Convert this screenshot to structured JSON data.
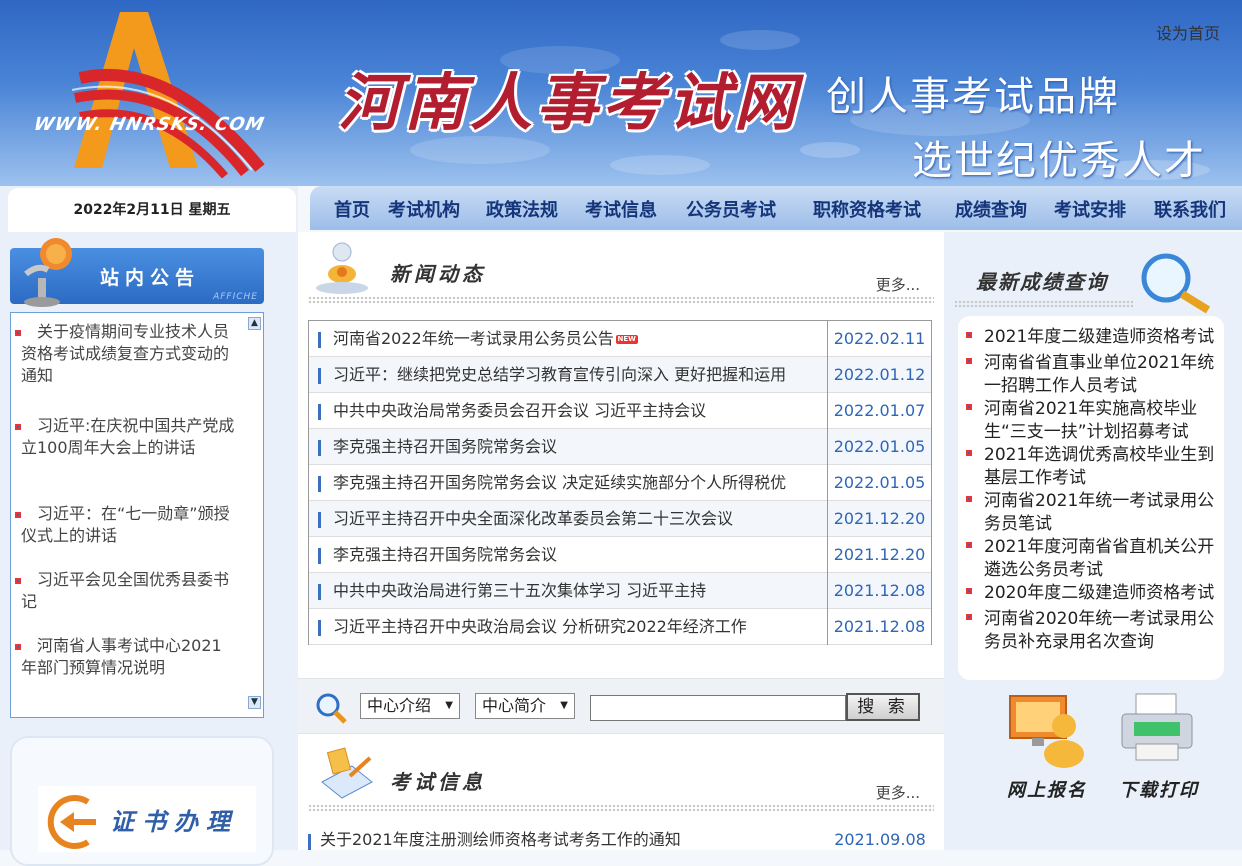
{
  "header": {
    "logo_text": "WWW. HNRSKS. COM",
    "site_title": "河南人事考试网",
    "slogan_1": "创人事考试品牌",
    "slogan_2": "选世纪优秀人才",
    "set_home": "设为首页"
  },
  "date": "2022年2月11日 星期五",
  "nav": [
    "首页",
    "考试机构",
    "政策法规",
    "考试信息",
    "公务员考试",
    "职称资格考试",
    "成绩查询",
    "考试安排",
    "联系我们"
  ],
  "notice": {
    "title": "站内公告",
    "subtitle": "AFFICHE",
    "items": [
      "关于疫情期间专业技术人员资格考试成绩复查方式变动的通知",
      "习近平:在庆祝中国共产党成立100周年大会上的讲话",
      "习近平：在“七一勋章”颁授仪式上的讲话",
      "习近平会见全国优秀县委书记",
      "河南省人事考试中心2021年部门预算情况说明"
    ]
  },
  "cert": {
    "title": "证书办理"
  },
  "news": {
    "title": "新闻动态",
    "more": "更多...",
    "new_badge": "NEW",
    "rows": [
      {
        "title": "河南省2022年统一考试录用公务员公告",
        "date": "2022.02.11",
        "is_new": true
      },
      {
        "title": "习近平：继续把党史总结学习教育宣传引向深入 更好把握和运用",
        "date": "2022.01.12"
      },
      {
        "title": "中共中央政治局常务委员会召开会议 习近平主持会议",
        "date": "2022.01.07"
      },
      {
        "title": "李克强主持召开国务院常务会议",
        "date": "2022.01.05"
      },
      {
        "title": "李克强主持召开国务院常务会议 决定延续实施部分个人所得税优",
        "date": "2022.01.05"
      },
      {
        "title": "习近平主持召开中央全面深化改革委员会第二十三次会议",
        "date": "2021.12.20"
      },
      {
        "title": "李克强主持召开国务院常务会议",
        "date": "2021.12.20"
      },
      {
        "title": "中共中央政治局进行第三十五次集体学习 习近平主持",
        "date": "2021.12.08"
      },
      {
        "title": "习近平主持召开中央政治局会议 分析研究2022年经济工作",
        "date": "2021.12.08"
      }
    ]
  },
  "search": {
    "select_1": "中心介绍",
    "select_2": "中心简介",
    "input_value": "",
    "button": "搜 索"
  },
  "exam_info": {
    "title": "考试信息",
    "more": "更多...",
    "rows": [
      {
        "title": "关于2021年度注册测绘师资格考试考务工作的通知",
        "date": "2021.09.08"
      }
    ]
  },
  "scores": {
    "title": "最新成绩查询",
    "items": [
      "2021年度二级建造师资格考试",
      "河南省省直事业单位2021年统一招聘工作人员考试",
      "河南省2021年实施高校毕业生“三支一扶”计划招募考试",
      "2021年选调优秀高校毕业生到基层工作考试",
      "河南省2021年统一考试录用公务员笔试",
      "2021年度河南省省直机关公开遴选公务员考试",
      "2020年度二级建造师资格考试",
      "河南省2020年统一考试录用公务员补充录用名次查询"
    ]
  },
  "tiles": {
    "register": "网上报名",
    "print": "下载打印"
  },
  "colors": {
    "nav_text": "#15357a",
    "date_blue": "#2e66b8",
    "title_red": "#b21e2f",
    "header_blue": "#2f67c4"
  }
}
